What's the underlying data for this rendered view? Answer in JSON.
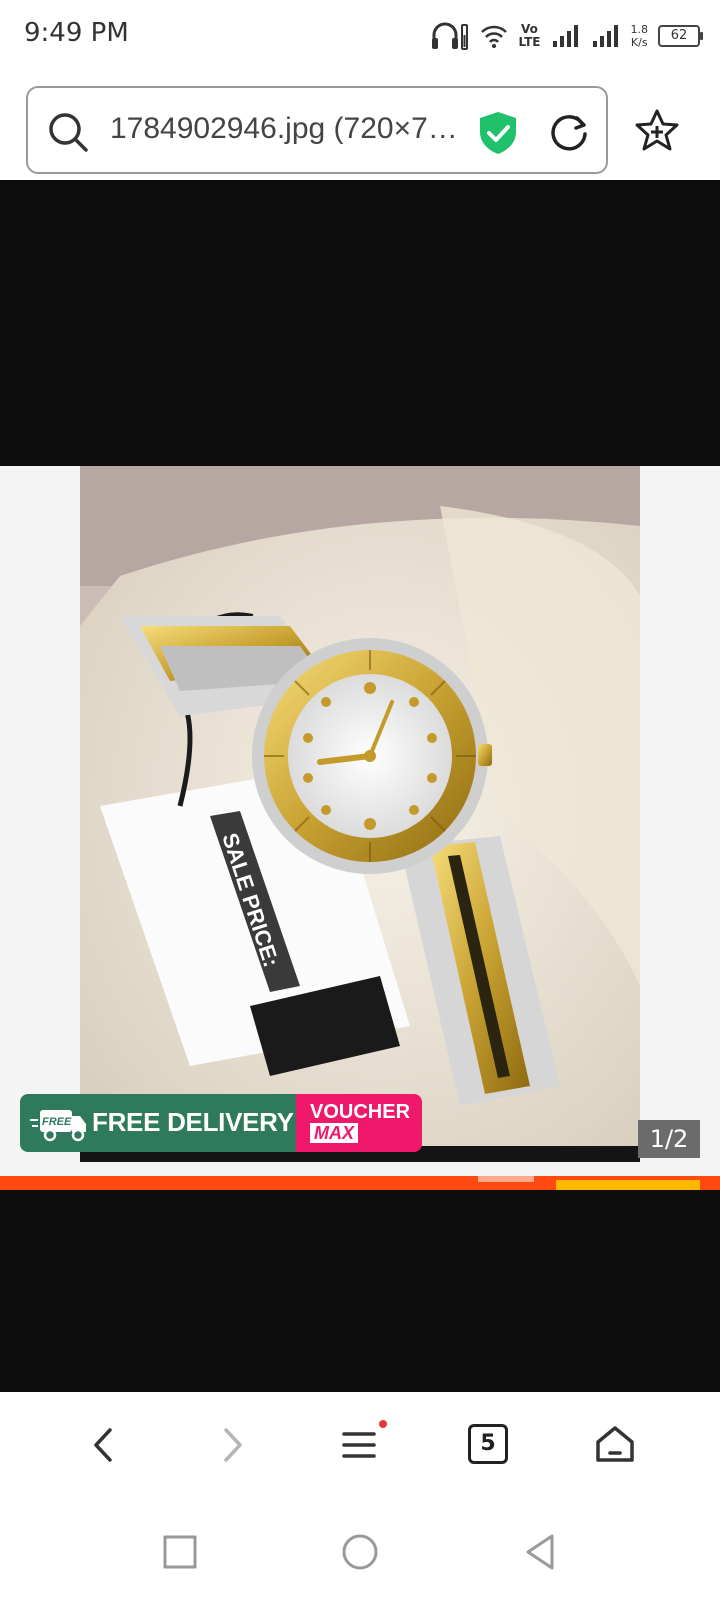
{
  "status_bar": {
    "time": "9:49 PM",
    "volte_top": "Vo",
    "volte_bottom": "LTE",
    "net_speed_value": "1.8",
    "net_speed_unit": "K/s",
    "battery": "62"
  },
  "address_bar": {
    "url_text": "1784902946.jpg (720×7…"
  },
  "product_image": {
    "tag_text": "SALE PRICE:"
  },
  "delivery_badge": {
    "truck_label": "FREE",
    "free_label": "FREE DELIVERY",
    "voucher_label": "VOUCHER",
    "max_label": "MAX"
  },
  "image_viewer": {
    "counter": "1/2"
  },
  "browser_toolbar": {
    "tab_count": "5"
  },
  "colors": {
    "free_delivery_bg": "#2f7a5d",
    "voucher_bg": "#f0186a",
    "promo_strip": "#ff4a0f",
    "security_shield": "#1fc26b"
  }
}
